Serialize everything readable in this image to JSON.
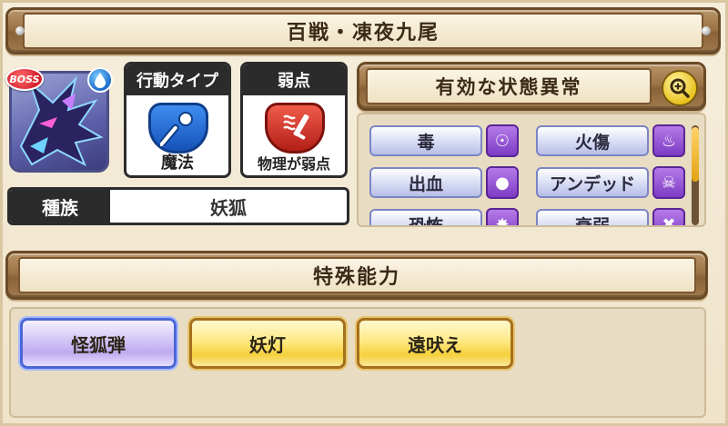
{
  "header": {
    "title": "百戦・凍夜九尾"
  },
  "enemy": {
    "badge": "BOSS",
    "element_icon": "water-drop-icon",
    "portrait_icon": "ice-fox-portrait"
  },
  "action_type": {
    "label": "行動タイプ",
    "value": "魔法",
    "icon": "magic-staff-icon"
  },
  "weakness": {
    "label": "弱点",
    "value": "物理が弱点",
    "icon": "sword-icon"
  },
  "race": {
    "label": "種族",
    "value": "妖狐"
  },
  "status_effects": {
    "title": "有効な状態異常",
    "magnify_icon": "magnify-plus-icon",
    "items": [
      {
        "label": "毒",
        "icon": "poison-icon"
      },
      {
        "label": "火傷",
        "icon": "flame-icon"
      },
      {
        "label": "出血",
        "icon": "blood-icon"
      },
      {
        "label": "アンデッド",
        "icon": "skull-icon"
      },
      {
        "label": "恐怖",
        "icon": "fear-icon"
      },
      {
        "label": "衰弱",
        "icon": "weaken-icon"
      }
    ]
  },
  "abilities": {
    "title": "特殊能力",
    "items": [
      {
        "label": "怪狐弾",
        "selected": true
      },
      {
        "label": "妖灯",
        "selected": false
      },
      {
        "label": "遠吠え",
        "selected": false
      }
    ]
  },
  "colors": {
    "wood": "#9c7446",
    "panel": "#e8dcc2",
    "status_pill": "#d6dbf4",
    "status_icon": "#7c3cc4",
    "ability_gold": "#f5d03d",
    "ability_selected": "#bfa9ef"
  }
}
